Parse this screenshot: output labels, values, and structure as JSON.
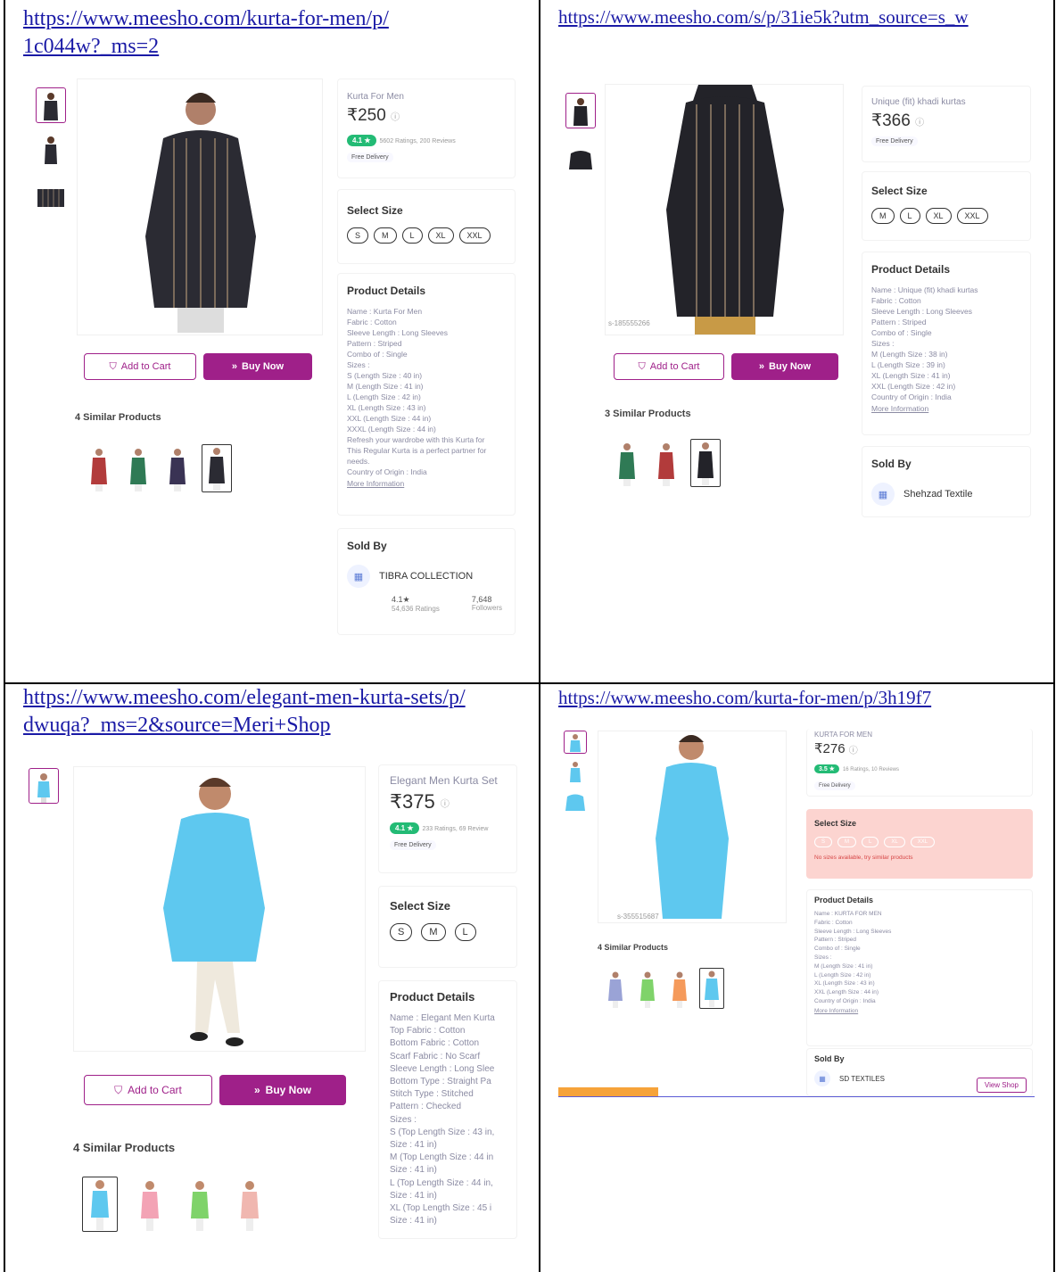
{
  "cells": [
    {
      "url": "https://www.meesho.com/kurta-for-men/p/1c044w?_ms=2",
      "product": {
        "title": "Kurta For Men",
        "price": "₹250",
        "rating": "4.1 ★",
        "rating_text": "5602 Ratings, 200 Reviews",
        "free_delivery": "Free Delivery",
        "select_size": "Select Size",
        "sizes": [
          "S",
          "M",
          "L",
          "XL",
          "XXL"
        ],
        "details_heading": "Product Details",
        "details": "Name : Kurta For Men\nFabric : Cotton\nSleeve Length : Long Sleeves\nPattern : Striped\nCombo of : Single\nSizes :\nS (Length Size : 40 in)\nM (Length Size : 41 in)\nL (Length Size : 42 in)\nXL (Length Size : 43 in)\nXXL (Length Size : 44 in)\nXXXL (Length Size : 44 in)\nRefresh your wardrobe with this Kurta for\nThis Regular Kurta is a perfect partner for\nneeds.\nCountry of Origin : India",
        "more_info": "More Information",
        "sold_by": "Sold By",
        "seller": "TIBRA COLLECTION",
        "seller_rating": "4.1★",
        "seller_ratings": "54,636 Ratings",
        "followers_count": "7,648",
        "followers_label": "Followers",
        "add_to_cart": "Add to Cart",
        "buy_now": "Buy Now",
        "similar": "4 Similar Products",
        "color": "#2b2b33",
        "similar_colors": [
          "#b23b3b",
          "#2f7a55",
          "#3a3354",
          "#2b2b33"
        ]
      }
    },
    {
      "url": "https://www.meesho.com/s/p/31ie5k?utm_source=s_w",
      "product": {
        "title": "Unique (fit) khadi kurtas",
        "price": "₹366",
        "free_delivery": "Free Delivery",
        "select_size": "Select Size",
        "sizes": [
          "M",
          "L",
          "XL",
          "XXL"
        ],
        "details_heading": "Product Details",
        "details": "Name : Unique (fit) khadi kurtas\nFabric : Cotton\nSleeve Length : Long Sleeves\nPattern : Striped\nCombo of : Single\nSizes :\nM (Length Size : 38 in)\nL (Length Size : 39 in)\nXL (Length Size : 41 in)\nXXL (Length Size : 42 in)\nCountry of Origin : India",
        "more_info": "More Information",
        "sold_by": "Sold By",
        "seller": "Shehzad Textile",
        "product_id": "s-185555266",
        "add_to_cart": "Add to Cart",
        "buy_now": "Buy Now",
        "similar": "3 Similar Products",
        "color": "#232329",
        "similar_colors": [
          "#2f7a55",
          "#b23b3b",
          "#232329"
        ]
      }
    },
    {
      "url": "https://www.meesho.com/elegant-men-kurta-sets/p/dwuqa?_ms=2&source=Meri+Shop",
      "product": {
        "title": "Elegant Men Kurta Set",
        "price": "₹375",
        "rating": "4.1 ★",
        "rating_text": "233 Ratings, 69 Review",
        "free_delivery": "Free Delivery",
        "select_size": "Select Size",
        "sizes": [
          "S",
          "M",
          "L"
        ],
        "details_heading": "Product Details",
        "details": "Name : Elegant Men Kurta\nTop Fabric : Cotton\nBottom Fabric : Cotton\nScarf Fabric : No Scarf\nSleeve Length : Long Slee\nBottom Type : Straight Pa\nStitch Type : Stitched\nPattern : Checked\nSizes :\nS (Top Length Size : 43 in,\nSize : 41 in)\nM (Top Length Size : 44 in\nSize : 41 in)\nL (Top Length Size : 44 in,\nSize : 41 in)\nXL (Top Length Size : 45 i\nSize : 41 in)",
        "add_to_cart": "Add to Cart",
        "buy_now": "Buy Now",
        "similar": "4 Similar Products",
        "color": "#5ec8ef",
        "similar_colors": [
          "#5ec8ef",
          "#f3a3b5",
          "#7fd36a",
          "#f0b7b0"
        ]
      }
    },
    {
      "url": "https://www.meesho.com/kurta-for-men/p/3h19f7",
      "product": {
        "title": "KURTA FOR MEN",
        "price": "₹276",
        "rating": "3.5 ★",
        "rating_text": "16 Ratings, 10 Reviews",
        "free_delivery": "Free Delivery",
        "select_size": "Select Size",
        "sizes": [
          "S",
          "M",
          "L",
          "XL",
          "XXL"
        ],
        "no_sizes": "No sizes available, try similar products",
        "details_heading": "Product Details",
        "details": "Name : KURTA FOR MEN\nFabric : Cotton\nSleeve Length : Long Sleeves\nPattern : Striped\nCombo of : Single\nSizes :\nM (Length Size : 41 in)\nL (Length Size : 42 in)\nXL (Length Size : 43 in)\nXXL (Length Size : 44 in)\nCountry of Origin : India",
        "more_info": "More Information",
        "sold_by": "Sold By",
        "seller": "SD TEXTILES",
        "view_shop": "View Shop",
        "product_id": "s-355515687",
        "similar": "4 Similar Products",
        "color": "#5ec8ef",
        "similar_colors": [
          "#9aa3d6",
          "#7fd36a",
          "#f59a5b",
          "#5ec8ef"
        ]
      }
    }
  ]
}
